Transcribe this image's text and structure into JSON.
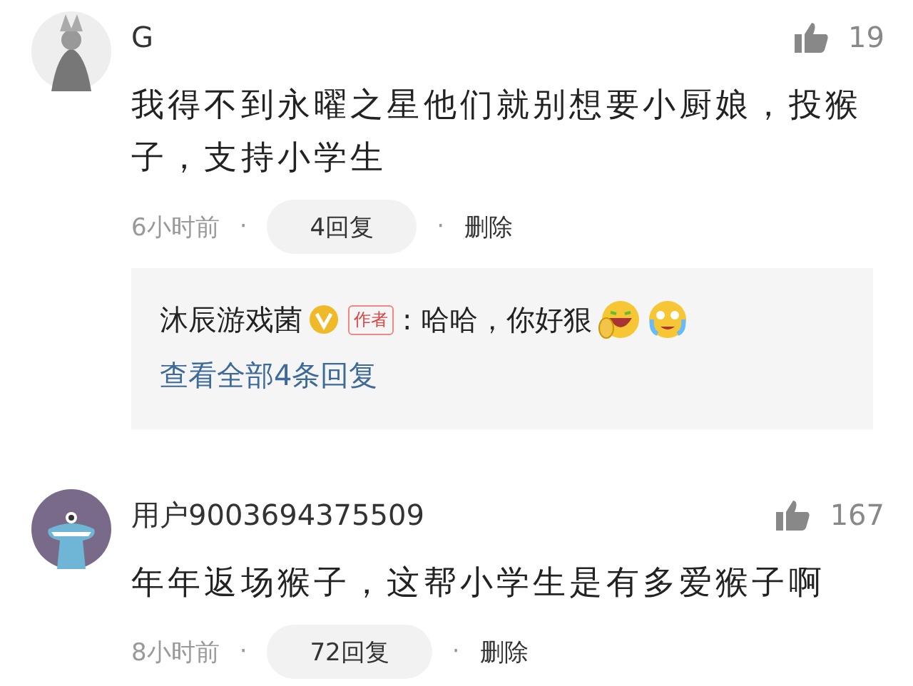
{
  "comments": [
    {
      "username": "G",
      "likes": "19",
      "text": "我得不到永曜之星他们就别想要小厨娘，投猴子，支持小学生",
      "time": "6小时前",
      "separator_1": "·",
      "replies": "4回复",
      "separator_2": "·",
      "delete": "删除",
      "reply_preview": {
        "author": "沐辰游戏菌",
        "tag": "作者",
        "text": ": 哈哈，你好狠",
        "link": "查看全部4条回复"
      }
    },
    {
      "username": "用户9003694375509",
      "likes": "167",
      "text": "年年返场猴子，这帮小学生是有多爱猴子啊",
      "time": "8小时前",
      "separator_1": "·",
      "replies": "72回复",
      "separator_2": "·",
      "delete": "删除"
    }
  ]
}
